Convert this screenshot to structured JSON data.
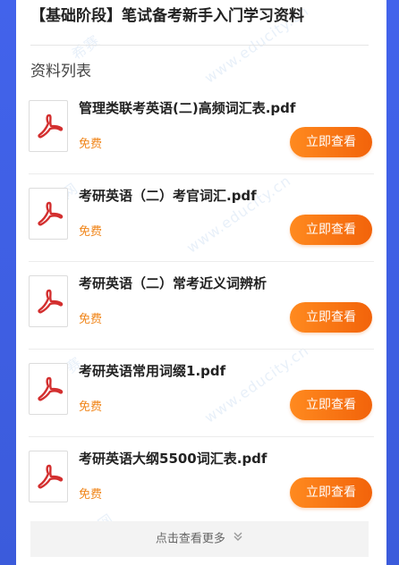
{
  "page": {
    "title": "【基础阶段】笔试备考新手入门学习资料",
    "section_heading": "资料列表",
    "watermark_text": "希赛网 www.educity.cn"
  },
  "items": [
    {
      "name": "管理类联考英语(二)高频词汇表.pdf",
      "price": "免费",
      "button": "立即查看",
      "icon": "pdf-file-icon"
    },
    {
      "name": "考研英语（二）考官词汇.pdf",
      "price": "免费",
      "button": "立即查看",
      "icon": "pdf-file-icon"
    },
    {
      "name": "考研英语（二）常考近义词辨析",
      "price": "免费",
      "button": "立即查看",
      "icon": "pdf-file-icon"
    },
    {
      "name": "考研英语常用词缀1.pdf",
      "price": "免费",
      "button": "立即查看",
      "icon": "pdf-file-icon"
    },
    {
      "name": "考研英语大纲5500词汇表.pdf",
      "price": "免费",
      "button": "立即查看",
      "icon": "pdf-file-icon"
    }
  ],
  "more": {
    "label": "点击查看更多",
    "icon": "double-chevron-down-icon"
  },
  "colors": {
    "accent": "#f2630a",
    "price": "#f08519",
    "pdf_red": "#d32f2f",
    "side_blue": "#3b5bdb"
  }
}
